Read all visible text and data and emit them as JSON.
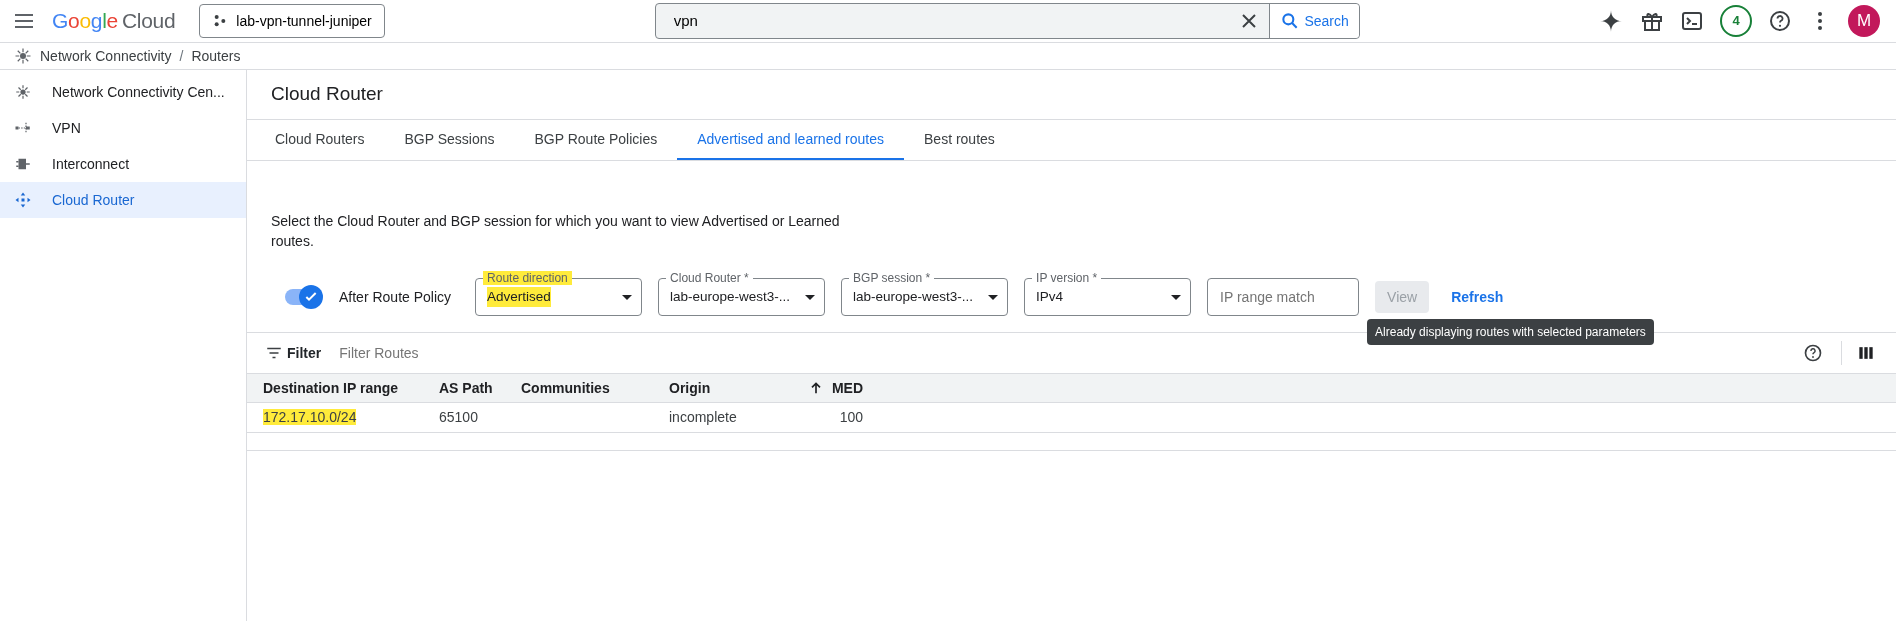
{
  "topbar": {
    "logo_word1": "Google",
    "logo_word2": "Cloud",
    "project": "lab-vpn-tunnel-juniper",
    "search": {
      "value": "vpn"
    },
    "search_button": "Search",
    "notifications": "4",
    "avatar": "M"
  },
  "breadcrumb": {
    "items": [
      "Network Connectivity",
      "Routers"
    ],
    "separator": "/"
  },
  "sidebar": {
    "items": [
      {
        "label": "Network Connectivity Cen...",
        "selected": false
      },
      {
        "label": "VPN",
        "selected": false
      },
      {
        "label": "Interconnect",
        "selected": false
      },
      {
        "label": "Cloud Router",
        "selected": true
      }
    ]
  },
  "page_title": "Cloud Router",
  "tabs": [
    {
      "label": "Cloud Routers",
      "selected": false
    },
    {
      "label": "BGP Sessions",
      "selected": false
    },
    {
      "label": "BGP Route Policies",
      "selected": false
    },
    {
      "label": "Advertised and learned routes",
      "selected": true
    },
    {
      "label": "Best routes",
      "selected": false
    }
  ],
  "description": "Select the Cloud Router and BGP session for which you want to view Advertised or Learned routes.",
  "toggle": {
    "label": "After Route Policy",
    "on": true
  },
  "selects": [
    {
      "label": "Route direction",
      "value": "Advertised",
      "highlighted": true
    },
    {
      "label": "Cloud Router *",
      "value": "lab-europe-west3-...",
      "highlighted": false
    },
    {
      "label": "BGP session *",
      "value": "lab-europe-west3-...",
      "highlighted": false
    },
    {
      "label": "IP version *",
      "value": "IPv4",
      "highlighted": false
    }
  ],
  "ip_range": {
    "placeholder": "IP range match"
  },
  "view_button": {
    "label": "View",
    "disabled": true
  },
  "refresh_button": "Refresh",
  "tooltip": "Already displaying routes with selected parameters",
  "filter": {
    "label": "Filter",
    "placeholder": "Filter Routes"
  },
  "table": {
    "columns": [
      {
        "label": "Destination IP range",
        "sorted": false
      },
      {
        "label": "AS Path",
        "sorted": false
      },
      {
        "label": "Communities",
        "sorted": false
      },
      {
        "label": "Origin",
        "sorted": false
      },
      {
        "label": "MED",
        "sorted": true
      }
    ],
    "rows": [
      {
        "cells": [
          "172.17.10.0/24",
          "65100",
          "",
          "incomplete",
          "100"
        ],
        "highlighted": true
      }
    ]
  }
}
